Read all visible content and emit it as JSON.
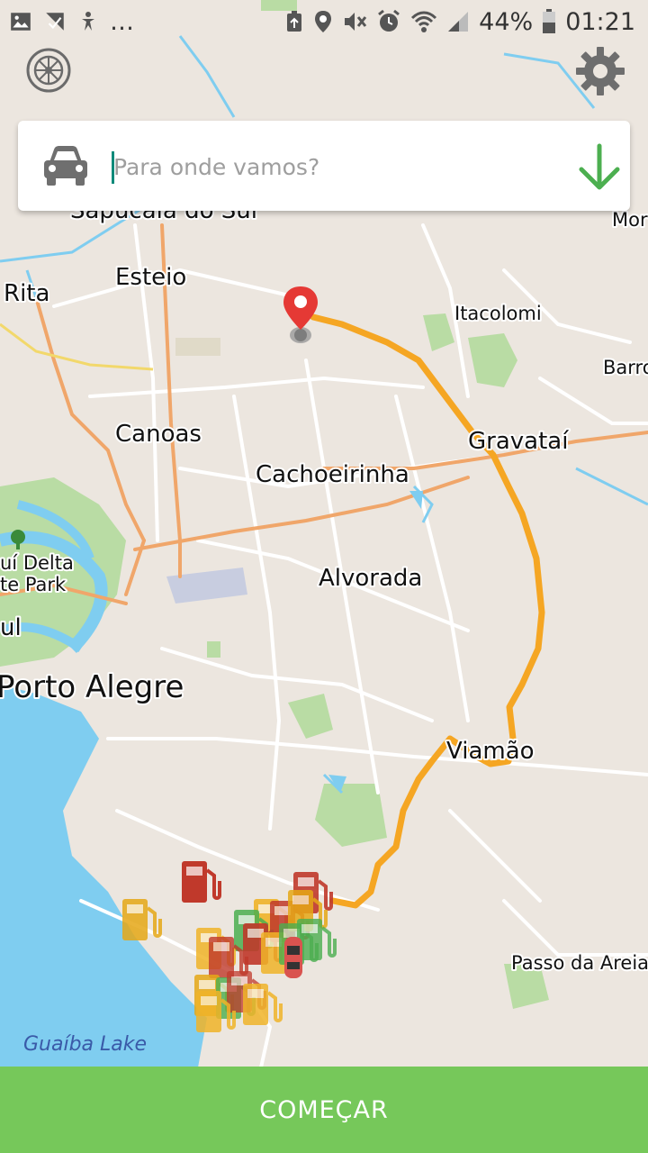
{
  "status_bar": {
    "battery": "44%",
    "time": "01:21",
    "left_icons": [
      "image-icon",
      "missed-call-icon",
      "accessibility-icon",
      "more-dots-icon"
    ],
    "right_icons": [
      "recycle-icon",
      "location-icon",
      "mute-icon",
      "alarm-icon",
      "wifi-icon",
      "signal-icon",
      "battery-icon"
    ]
  },
  "search": {
    "placeholder": "Para onde vamos?",
    "value": ""
  },
  "primary_button": {
    "label": "COMEÇAR"
  },
  "map": {
    "labels": [
      {
        "text": "Sapucaia do Sul",
        "cls": "lbl-mid"
      },
      {
        "text": "Esteio",
        "cls": "lbl-mid"
      },
      {
        "text": "Rita",
        "cls": "lbl-mid"
      },
      {
        "text": "Canoas",
        "cls": "lbl-mid"
      },
      {
        "text": "Cachoeirinha",
        "cls": "lbl-mid"
      },
      {
        "text": "Gravataí",
        "cls": "lbl-mid"
      },
      {
        "text": "Alvorada",
        "cls": "lbl-mid"
      },
      {
        "text": "Porto Alegre",
        "cls": "lbl-big"
      },
      {
        "text": "Viamão",
        "cls": "lbl-mid"
      },
      {
        "text": "Itacolomi",
        "cls": "lbl-sm"
      },
      {
        "text": "Barro",
        "cls": "lbl-sm"
      },
      {
        "text": "Mor",
        "cls": "lbl-sm"
      },
      {
        "text": "uí Delta",
        "cls": "lbl-sm"
      },
      {
        "text": "te Park",
        "cls": "lbl-sm"
      },
      {
        "text": "ul",
        "cls": "lbl-mid"
      },
      {
        "text": "Passo da Areia",
        "cls": "lbl-sm"
      },
      {
        "text": "Guaíba Lake",
        "cls": "lbl-water"
      }
    ],
    "fuel_station_colors": [
      "#c0392b",
      "#e6a817",
      "#f0b429",
      "#4caf50"
    ],
    "route_color": "#f5a623",
    "water_color": "#7fcdf0",
    "park_color": "#b9dca4",
    "land_color": "#ece6df"
  },
  "colors": {
    "accent": "#76c85a",
    "arrow": "#4caf50"
  }
}
